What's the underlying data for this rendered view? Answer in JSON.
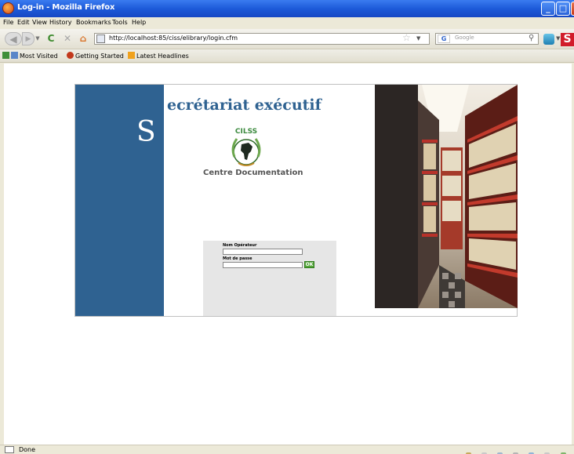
{
  "window": {
    "title": "Log-in - Mozilla Firefox",
    "minimize": "_",
    "maximize": "□",
    "close": "X"
  },
  "menu": {
    "items": [
      "File",
      "Edit",
      "View",
      "History",
      "Bookmarks",
      "Tools",
      "Help"
    ]
  },
  "nav": {
    "url": "http://localhost:85/ciss/elibrary/login.cfm",
    "search_placeholder": "Google",
    "search_engine": "G"
  },
  "bookmarks": {
    "items": [
      "Most Visited",
      "Getting Started",
      "Latest Headlines"
    ]
  },
  "page": {
    "big_letter": "S",
    "headline": "ecrétariat exécutif",
    "logo_text": "CILSS",
    "center_label": "Centre Documentation",
    "form": {
      "operator_label": "Nom Opérateur",
      "operator_value": "",
      "password_label": "Mot de passe",
      "password_value": "",
      "submit_label": "OK"
    },
    "colors": {
      "panel_blue": "#2f6291",
      "form_bg": "#e6e6e6",
      "ok_green": "#55a63a"
    }
  },
  "status": {
    "text": "Done"
  }
}
